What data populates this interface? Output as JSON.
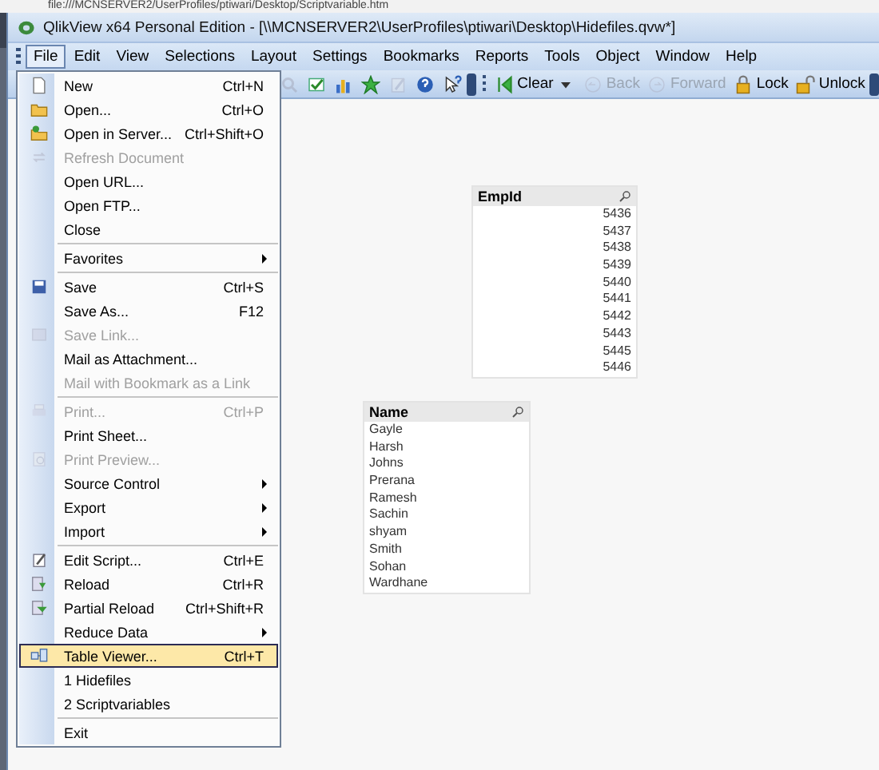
{
  "url_strip": {
    "text": "file:///MCNSERVER2/UserProfiles/ptiwari/Desktop/Scriptvariable.htm"
  },
  "window": {
    "title": "QlikView x64 Personal Edition - [\\\\MCNSERVER2\\UserProfiles\\ptiwari\\Desktop\\Hidefiles.qvw*]"
  },
  "menu_bar": [
    {
      "label": "File",
      "selected": true
    },
    {
      "label": "Edit",
      "selected": false
    },
    {
      "label": "View",
      "selected": false
    },
    {
      "label": "Selections",
      "selected": false
    },
    {
      "label": "Layout",
      "selected": false
    },
    {
      "label": "Settings",
      "selected": false
    },
    {
      "label": "Bookmarks",
      "selected": false
    },
    {
      "label": "Reports",
      "selected": false
    },
    {
      "label": "Tools",
      "selected": false
    },
    {
      "label": "Object",
      "selected": false
    },
    {
      "label": "Window",
      "selected": false
    },
    {
      "label": "Help",
      "selected": false
    }
  ],
  "toolbar": [
    {
      "kind": "search",
      "disabled": true
    },
    {
      "kind": "check",
      "disabled": false
    },
    {
      "kind": "chart",
      "disabled": false
    },
    {
      "kind": "star",
      "disabled": false
    },
    {
      "kind": "edit",
      "disabled": true
    },
    {
      "kind": "help",
      "disabled": false
    },
    {
      "kind": "pointer",
      "disabled": false
    },
    {
      "kind": "overflow"
    },
    {
      "kind": "grip"
    },
    {
      "kind": "clear",
      "label": "Clear",
      "disabled": false
    },
    {
      "kind": "back",
      "label": "Back",
      "disabled": true
    },
    {
      "kind": "forward",
      "label": "Forward",
      "disabled": true
    },
    {
      "kind": "lock",
      "label": "Lock",
      "disabled": false
    },
    {
      "kind": "unlock",
      "label": "Unlock",
      "disabled": false
    },
    {
      "kind": "overflow"
    }
  ],
  "file_menu": [
    {
      "kind": "item",
      "label": "New",
      "shortcut": "Ctrl+N",
      "disabled": false,
      "selected": false
    },
    {
      "kind": "item",
      "label": "Open...",
      "shortcut": "Ctrl+O",
      "disabled": false,
      "selected": false
    },
    {
      "kind": "item",
      "label": "Open in Server...",
      "shortcut": "Ctrl+Shift+O",
      "disabled": false,
      "selected": false
    },
    {
      "kind": "item",
      "label": "Refresh Document",
      "disabled": true,
      "selected": false
    },
    {
      "kind": "item",
      "label": "Open URL...",
      "disabled": false,
      "selected": false
    },
    {
      "kind": "item",
      "label": "Open FTP...",
      "disabled": false,
      "selected": false
    },
    {
      "kind": "item",
      "label": "Close",
      "disabled": false,
      "selected": false
    },
    {
      "kind": "separator"
    },
    {
      "kind": "submenu",
      "label": "Favorites",
      "disabled": false,
      "selected": false
    },
    {
      "kind": "separator"
    },
    {
      "kind": "item",
      "label": "Save",
      "shortcut": "Ctrl+S",
      "disabled": false,
      "selected": false
    },
    {
      "kind": "item",
      "label": "Save As...",
      "shortcut": "F12",
      "disabled": false,
      "selected": false
    },
    {
      "kind": "item",
      "label": "Save Link...",
      "disabled": true,
      "selected": false
    },
    {
      "kind": "item",
      "label": "Mail as Attachment...",
      "disabled": false,
      "selected": false
    },
    {
      "kind": "item",
      "label": "Mail with Bookmark as a Link",
      "disabled": true,
      "selected": false
    },
    {
      "kind": "separator"
    },
    {
      "kind": "item",
      "label": "Print...",
      "shortcut": "Ctrl+P",
      "disabled": true,
      "selected": false
    },
    {
      "kind": "item",
      "label": "Print Sheet...",
      "disabled": false,
      "selected": false
    },
    {
      "kind": "item",
      "label": "Print Preview...",
      "disabled": true,
      "selected": false
    },
    {
      "kind": "submenu",
      "label": "Source Control",
      "disabled": false,
      "selected": false
    },
    {
      "kind": "submenu",
      "label": "Export",
      "disabled": false,
      "selected": false
    },
    {
      "kind": "submenu",
      "label": "Import",
      "disabled": false,
      "selected": false
    },
    {
      "kind": "separator"
    },
    {
      "kind": "item",
      "label": "Edit Script...",
      "shortcut": "Ctrl+E",
      "disabled": false,
      "selected": false
    },
    {
      "kind": "item",
      "label": "Reload",
      "shortcut": "Ctrl+R",
      "disabled": false,
      "selected": false
    },
    {
      "kind": "item",
      "label": "Partial Reload",
      "shortcut": "Ctrl+Shift+R",
      "disabled": false,
      "selected": false
    },
    {
      "kind": "submenu",
      "label": "Reduce Data",
      "disabled": false,
      "selected": false
    },
    {
      "kind": "item",
      "label": "Table Viewer...",
      "shortcut": "Ctrl+T",
      "disabled": false,
      "selected": true
    },
    {
      "kind": "item",
      "label": "1 Hidefiles",
      "disabled": false,
      "selected": false
    },
    {
      "kind": "item",
      "label": "2 Scriptvariables",
      "disabled": false,
      "selected": false
    },
    {
      "kind": "separator"
    },
    {
      "kind": "item",
      "label": "Exit",
      "disabled": false,
      "selected": false
    }
  ],
  "list_boxes": [
    {
      "title": "EmpId",
      "kind": "numeric",
      "values": [
        "5436",
        "5437",
        "5438",
        "5439",
        "5440",
        "5441",
        "5442",
        "5443",
        "5445",
        "5446"
      ]
    },
    {
      "title": "Name",
      "kind": "text",
      "values": [
        "Gayle",
        "Harsh",
        "Johns",
        "Prerana",
        "Ramesh",
        "Sachin",
        "shyam",
        "Smith",
        "Sohan",
        "Wardhane"
      ]
    }
  ]
}
